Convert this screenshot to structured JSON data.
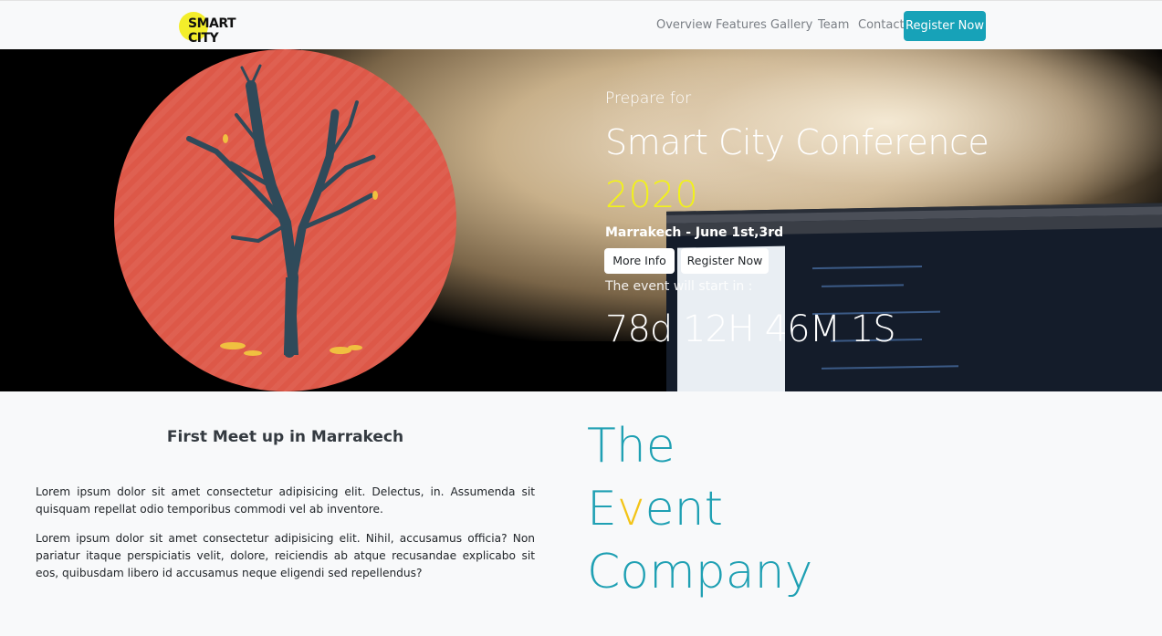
{
  "navbar": {
    "logo_text": "SMART CITY",
    "links": [
      "Overview",
      "Features",
      "Gallery",
      "Team",
      "Contact"
    ],
    "register_button": "Register Now"
  },
  "hero": {
    "prepare": "Prepare for",
    "title": "Smart City Conference",
    "year": "2020",
    "place_date": "Marrakech - June 1st,3rd",
    "more_info_button": "More Info",
    "register_button": "Register Now",
    "countdown_label": "The event will start in :",
    "countdown": "78d 12H 46M 1S"
  },
  "about": {
    "title": "First Meet up in Marrakech",
    "paragraphs": [
      "Lorem ipsum dolor sit amet consectetur adipisicing elit. Delectus, in. Assumenda sit quisquam repellat odio temporibus commodi vel ab inventore.",
      "Lorem ipsum dolor sit amet consectetur adipisicing elit. Nihil, accusamus officia? Non pariatur itaque perspiciatis velit, dolore, reiciendis ab atque recusandae explicabo sit eos, quibusdam libero id accusamus neque eligendi sed repellendus?"
    ]
  },
  "tagline": {
    "line1": "The",
    "line2_start": "E",
    "line2_highlight": "v",
    "line2_end": "ent",
    "line3": "Company"
  },
  "colors": {
    "accent": "#17a2b8",
    "highlight": "#f3c417",
    "year": "#f2f21a",
    "circle": "#dd5848"
  }
}
